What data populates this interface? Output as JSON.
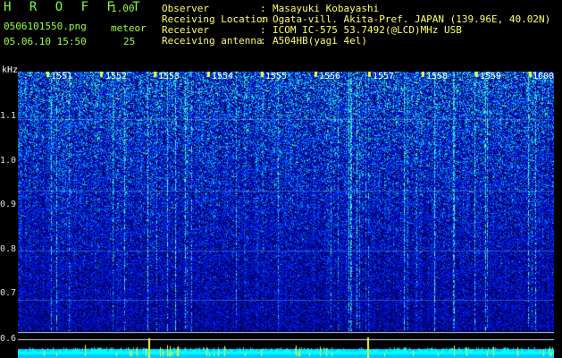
{
  "header": {
    "app_title": "H R O F F T",
    "app_version": "1.00",
    "file_name": "0506101550.png",
    "meteor_label": "meteor",
    "datetime": "05.06.10 15:50",
    "meteor_count": "25"
  },
  "info": [
    {
      "label": "Observer",
      "value": "Masayuki Kobayashi"
    },
    {
      "label": "Receiving Location",
      "value": "Ogata-vill. Akita-Pref. JAPAN (139.96E, 40.02N)"
    },
    {
      "label": "Receiver",
      "value": "ICOM IC-575 53.7492(@LCD)MHz USB"
    },
    {
      "label": "Receiving antenna",
      "value": "A504HB(yagi 4el)"
    }
  ],
  "y_axis": {
    "unit": "kHz",
    "ticks": [
      "1.1",
      "1.0",
      "0.9",
      "0.8",
      "0.7",
      "0.6"
    ]
  },
  "time_marks": [
    "1551",
    "1552",
    "1553",
    "1554",
    "1555",
    "1556",
    "1557",
    "1558",
    "1559",
    "1600"
  ],
  "colors": {
    "background": "#000000",
    "title": "#7dff3a",
    "info_text": "#ffff66",
    "noise_base": "#0a1a8a",
    "noise_bright": "#00e0ff",
    "signal_trace": "#f0ff40",
    "baseline": "#00ffff"
  }
}
